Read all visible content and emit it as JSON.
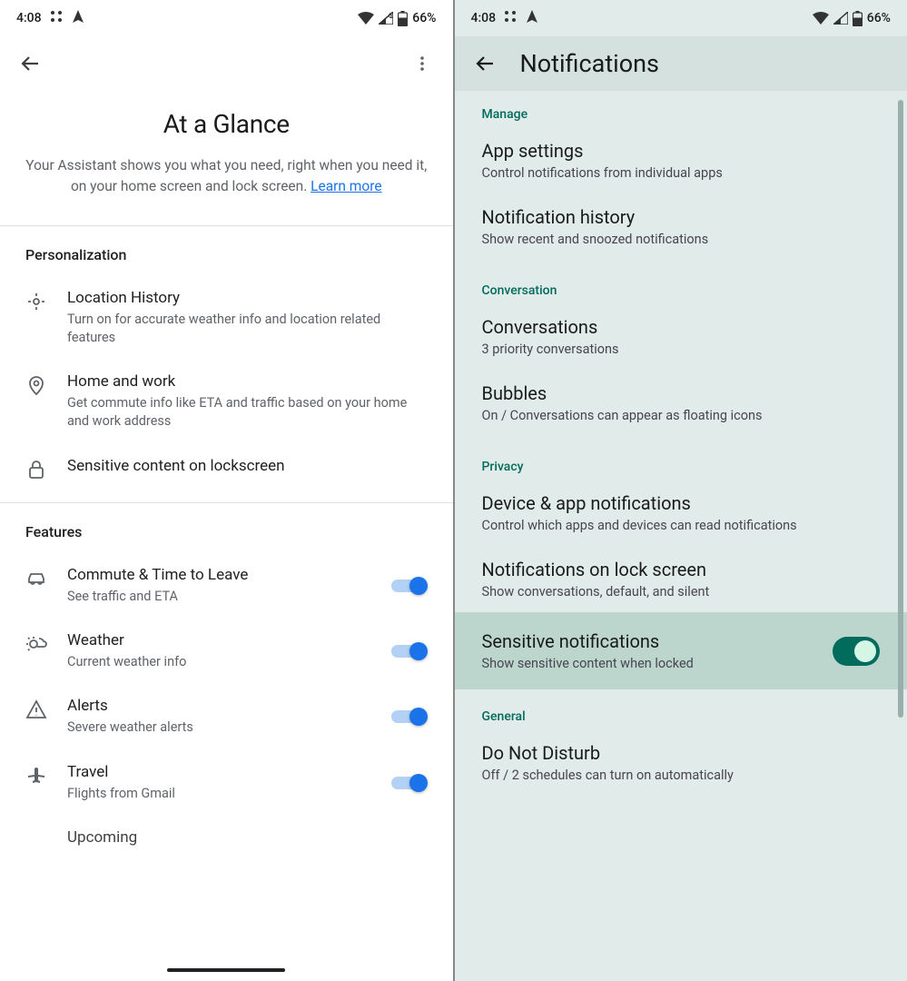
{
  "status": {
    "time": "4:08",
    "battery": "66%"
  },
  "left": {
    "title": "At a Glance",
    "subtitle_a": "Your Assistant shows you what you need, right when you need it, on your home screen and lock screen. ",
    "learn_more": "Learn more",
    "sections": {
      "personalization": {
        "title": "Personalization",
        "items": [
          {
            "title": "Location History",
            "sub": "Turn on for accurate weather info and location related features"
          },
          {
            "title": "Home and work",
            "sub": "Get commute info like ETA and traffic based on your home and work address"
          },
          {
            "title": "Sensitive content on lockscreen",
            "sub": ""
          }
        ]
      },
      "features": {
        "title": "Features",
        "items": [
          {
            "title": "Commute & Time to Leave",
            "sub": "See traffic and ETA"
          },
          {
            "title": "Weather",
            "sub": "Current weather info"
          },
          {
            "title": "Alerts",
            "sub": "Severe weather alerts"
          },
          {
            "title": "Travel",
            "sub": "Flights from Gmail"
          },
          {
            "title": "Upcoming",
            "sub": ""
          }
        ]
      }
    }
  },
  "right": {
    "title": "Notifications",
    "groups": {
      "manage": {
        "label": "Manage",
        "items": [
          {
            "title": "App settings",
            "sub": "Control notifications from individual apps"
          },
          {
            "title": "Notification history",
            "sub": "Show recent and snoozed notifications"
          }
        ]
      },
      "conversation": {
        "label": "Conversation",
        "items": [
          {
            "title": "Conversations",
            "sub": "3 priority conversations"
          },
          {
            "title": "Bubbles",
            "sub": "On / Conversations can appear as floating icons"
          }
        ]
      },
      "privacy": {
        "label": "Privacy",
        "items": [
          {
            "title": "Device & app notifications",
            "sub": "Control which apps and devices can read notifications"
          },
          {
            "title": "Notifications on lock screen",
            "sub": "Show conversations, default, and silent"
          },
          {
            "title": "Sensitive notifications",
            "sub": "Show sensitive content when locked"
          }
        ]
      },
      "general": {
        "label": "General",
        "items": [
          {
            "title": "Do Not Disturb",
            "sub": "Off / 2 schedules can turn on automatically"
          }
        ]
      }
    }
  }
}
